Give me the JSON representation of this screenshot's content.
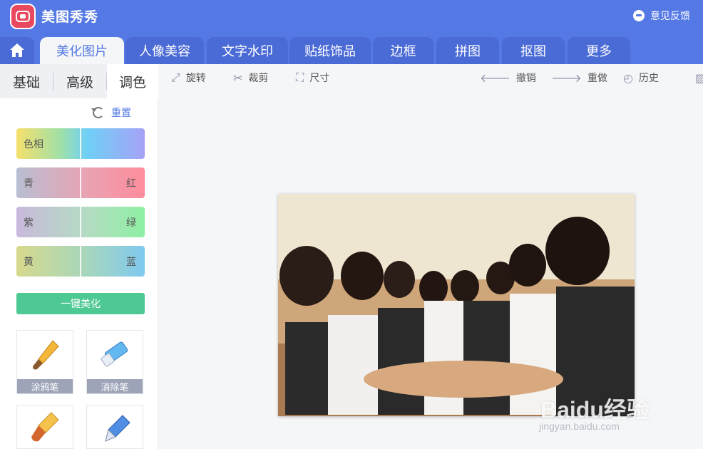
{
  "app": {
    "title": "美图秀秀",
    "feedback_label": "意见反馈"
  },
  "tabs": [
    {
      "label": "美化图片",
      "active": true
    },
    {
      "label": "人像美容"
    },
    {
      "label": "文字水印"
    },
    {
      "label": "贴纸饰品"
    },
    {
      "label": "边框"
    },
    {
      "label": "拼图"
    },
    {
      "label": "抠图"
    },
    {
      "label": "更多"
    }
  ],
  "left_panel": {
    "subtabs": [
      {
        "label": "基础"
      },
      {
        "label": "高级"
      },
      {
        "label": "调色",
        "active": true
      }
    ],
    "reset_label": "重置",
    "sliders": [
      {
        "left": "色相",
        "right": "",
        "level": 0.5
      },
      {
        "left": "青",
        "right": "红",
        "level": 0.5
      },
      {
        "left": "紫",
        "right": "绿",
        "level": 0.5
      },
      {
        "left": "黄",
        "right": "蓝",
        "level": 0.5
      }
    ],
    "onekey_label": "一键美化",
    "tools": [
      {
        "label": "涂鸦笔",
        "icon": "brush-icon"
      },
      {
        "label": "消除笔",
        "icon": "eraser-icon"
      },
      {
        "label": "",
        "icon": "paint-brush-icon"
      },
      {
        "label": "",
        "icon": "pen-icon"
      }
    ]
  },
  "toolbar": {
    "rotate": "旋转",
    "crop": "裁剪",
    "size": "尺寸",
    "undo": "撤销",
    "redo": "重做",
    "history": "历史"
  },
  "watermark": {
    "main": "Baidu经验",
    "sub": "jingyan.baidu.com"
  },
  "colors": {
    "header": "#5478e4",
    "tab_inactive": "#4a6ad6",
    "accent_green": "#4ec993",
    "caption_gray": "#9da4b8"
  }
}
